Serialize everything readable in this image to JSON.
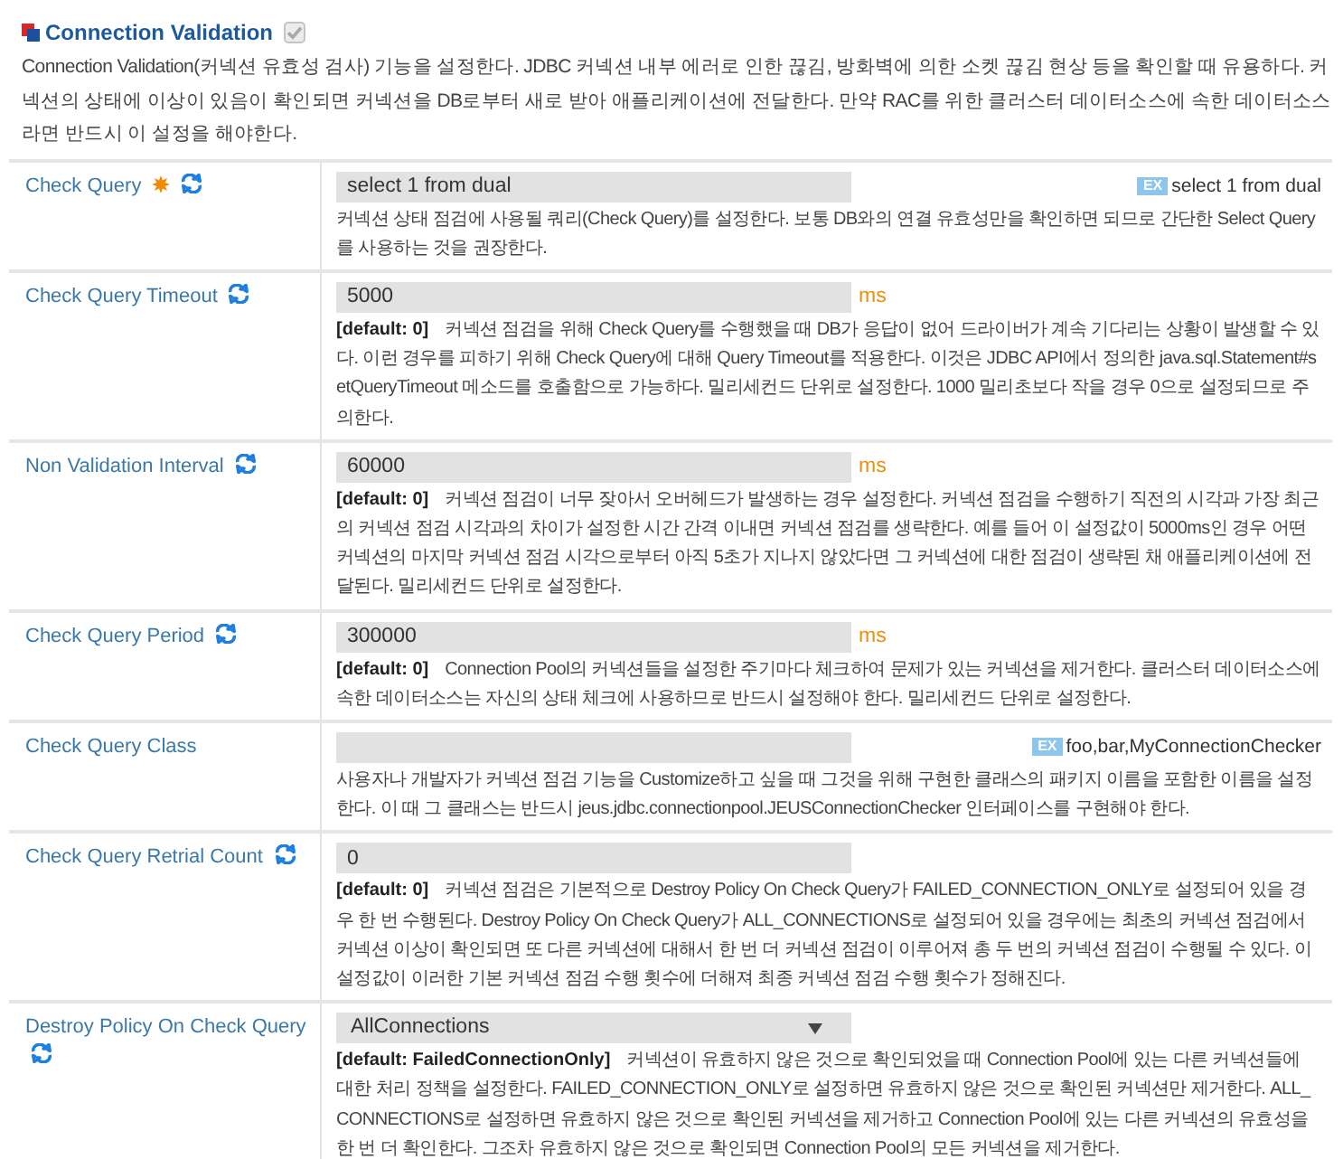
{
  "section": {
    "title": "Connection Validation",
    "checkbox": {
      "checked": true,
      "disabled": true
    },
    "description": "Connection Validation(커넥션 유효성 검사) 기능을 설정한다. JDBC 커넥션 내부 에러로 인한 끊김, 방화벽에 의한 소켓 끊김 현상 등을 확인할 때 유용하다. 커넥션의 상태에 이상이 있음이 확인되면 커넥션을 DB로부터 새로 받아 애플리케이션에 전달한다. 만약 RAC를 위한 클러스터 데이터소스에 속한 데이터소스라면 반드시 이 설정을 해야한다."
  },
  "settings": [
    {
      "label": "Check Query",
      "required": true,
      "dynamic": true,
      "kind": "text",
      "value": "select 1 from dual",
      "example": {
        "badge": "EX",
        "text": "select 1 from dual"
      },
      "description": "커넥션 상태 점검에 사용될 쿼리(Check Query)를 설정한다. 보통 DB와의 연결 유효성만을 확인하면 되므로 간단한 Select Query를 사용하는 것을 권장한다."
    },
    {
      "label": "Check Query Timeout",
      "required": false,
      "dynamic": true,
      "kind": "text",
      "value": "5000",
      "unit": "ms",
      "default": "[default: 0]",
      "description": "커넥션 점검을 위해 Check Query를 수행했을 때 DB가 응답이 없어 드라이버가 계속 기다리는 상황이 발생할 수 있다. 이런 경우를 피하기 위해 Check Query에 대해 Query Timeout를 적용한다. 이것은 JDBC API에서 정의한 java.sql.Statement#setQueryTimeout 메소드를 호출함으로 가능하다. 밀리세컨드 단위로 설정한다. 1000 밀리초보다 작을 경우 0으로 설정되므로 주의한다."
    },
    {
      "label": "Non Validation Interval",
      "required": false,
      "dynamic": true,
      "kind": "text",
      "value": "60000",
      "unit": "ms",
      "default": "[default: 0]",
      "description": "커넥션 점검이 너무 잦아서 오버헤드가 발생하는 경우 설정한다. 커넥션 점검을 수행하기 직전의 시각과 가장 최근의 커넥션 점검 시각과의 차이가 설정한 시간 간격 이내면 커넥션 점검를 생략한다. 예를 들어 이 설정값이 5000ms인 경우 어떤 커넥션의 마지막 커넥션 점검 시각으로부터 아직 5초가 지나지 않았다면 그 커넥션에 대한 점검이 생략된 채 애플리케이션에 전달된다. 밀리세컨드 단위로 설정한다."
    },
    {
      "label": "Check Query Period",
      "required": false,
      "dynamic": true,
      "kind": "text",
      "value": "300000",
      "unit": "ms",
      "default": "[default: 0]",
      "description": "Connection Pool의 커넥션들을 설정한 주기마다 체크하여 문제가 있는 커넥션을 제거한다. 클러스터 데이터소스에 속한 데이터소스는 자신의 상태 체크에 사용하므로 반드시 설정해야 한다. 밀리세컨드 단위로 설정한다."
    },
    {
      "label": "Check Query Class",
      "required": false,
      "dynamic": false,
      "kind": "text",
      "example": {
        "badge": "EX",
        "text": "foo,bar,MyConnectionChecker"
      },
      "description": "사용자나 개발자가 커넥션 점검 기능을 Customize하고 싶을 때 그것을 위해 구현한 클래스의 패키지 이름을 포함한 이름을 설정한다. 이 때 그 클래스는 반드시 jeus.jdbc.connectionpool.JEUSConnectionChecker 인터페이스를 구현해야 한다."
    },
    {
      "label": "Check Query Retrial Count",
      "required": false,
      "dynamic": true,
      "kind": "text",
      "value": "0",
      "default": "[default: 0]",
      "description": "커넥션 점검은 기본적으로 Destroy Policy On Check Query가 FAILED_CONNECTION_ONLY로 설정되어 있을 경우 한 번 수행된다. Destroy Policy On Check Query가 ALL_CONNECTIONS로 설정되어 있을 경우에는 최초의 커넥션 점검에서 커넥션 이상이 확인되면 또 다른 커넥션에 대해서 한 번 더 커넥션 점검이 이루어져 총 두 번의 커넥션 점검이 수행될 수 있다. 이 설정값이 이러한 기본 커넥션 점검 수행 횟수에 더해져 최종 커넥션 점검 수행 횟수가 정해진다."
    },
    {
      "label": "Destroy Policy On Check Query",
      "required": false,
      "dynamic": true,
      "kind": "select",
      "value": "AllConnections",
      "default": "[default: FailedConnectionOnly]",
      "description": "커넥션이 유효하지 않은 것으로 확인되었을 때 Connection Pool에 있는 다른 커넥션들에 대한 처리 정책을 설정한다. FAILED_CONNECTION_ONLY로 설정하면 유효하지 않은 것으로 확인된 커넥션만 제거한다. ALL_CONNECTIONS로 설정하면 유효하지 않은 것으로 확인된 커넥션을 제거하고 Connection Pool에 있는 다른 커넥션의 유효성을 한 번 더 확인한다. 그조차 유효하지 않은 것으로 확인되면 Connection Pool의 모든 커넥션을 제거한다."
    }
  ]
}
